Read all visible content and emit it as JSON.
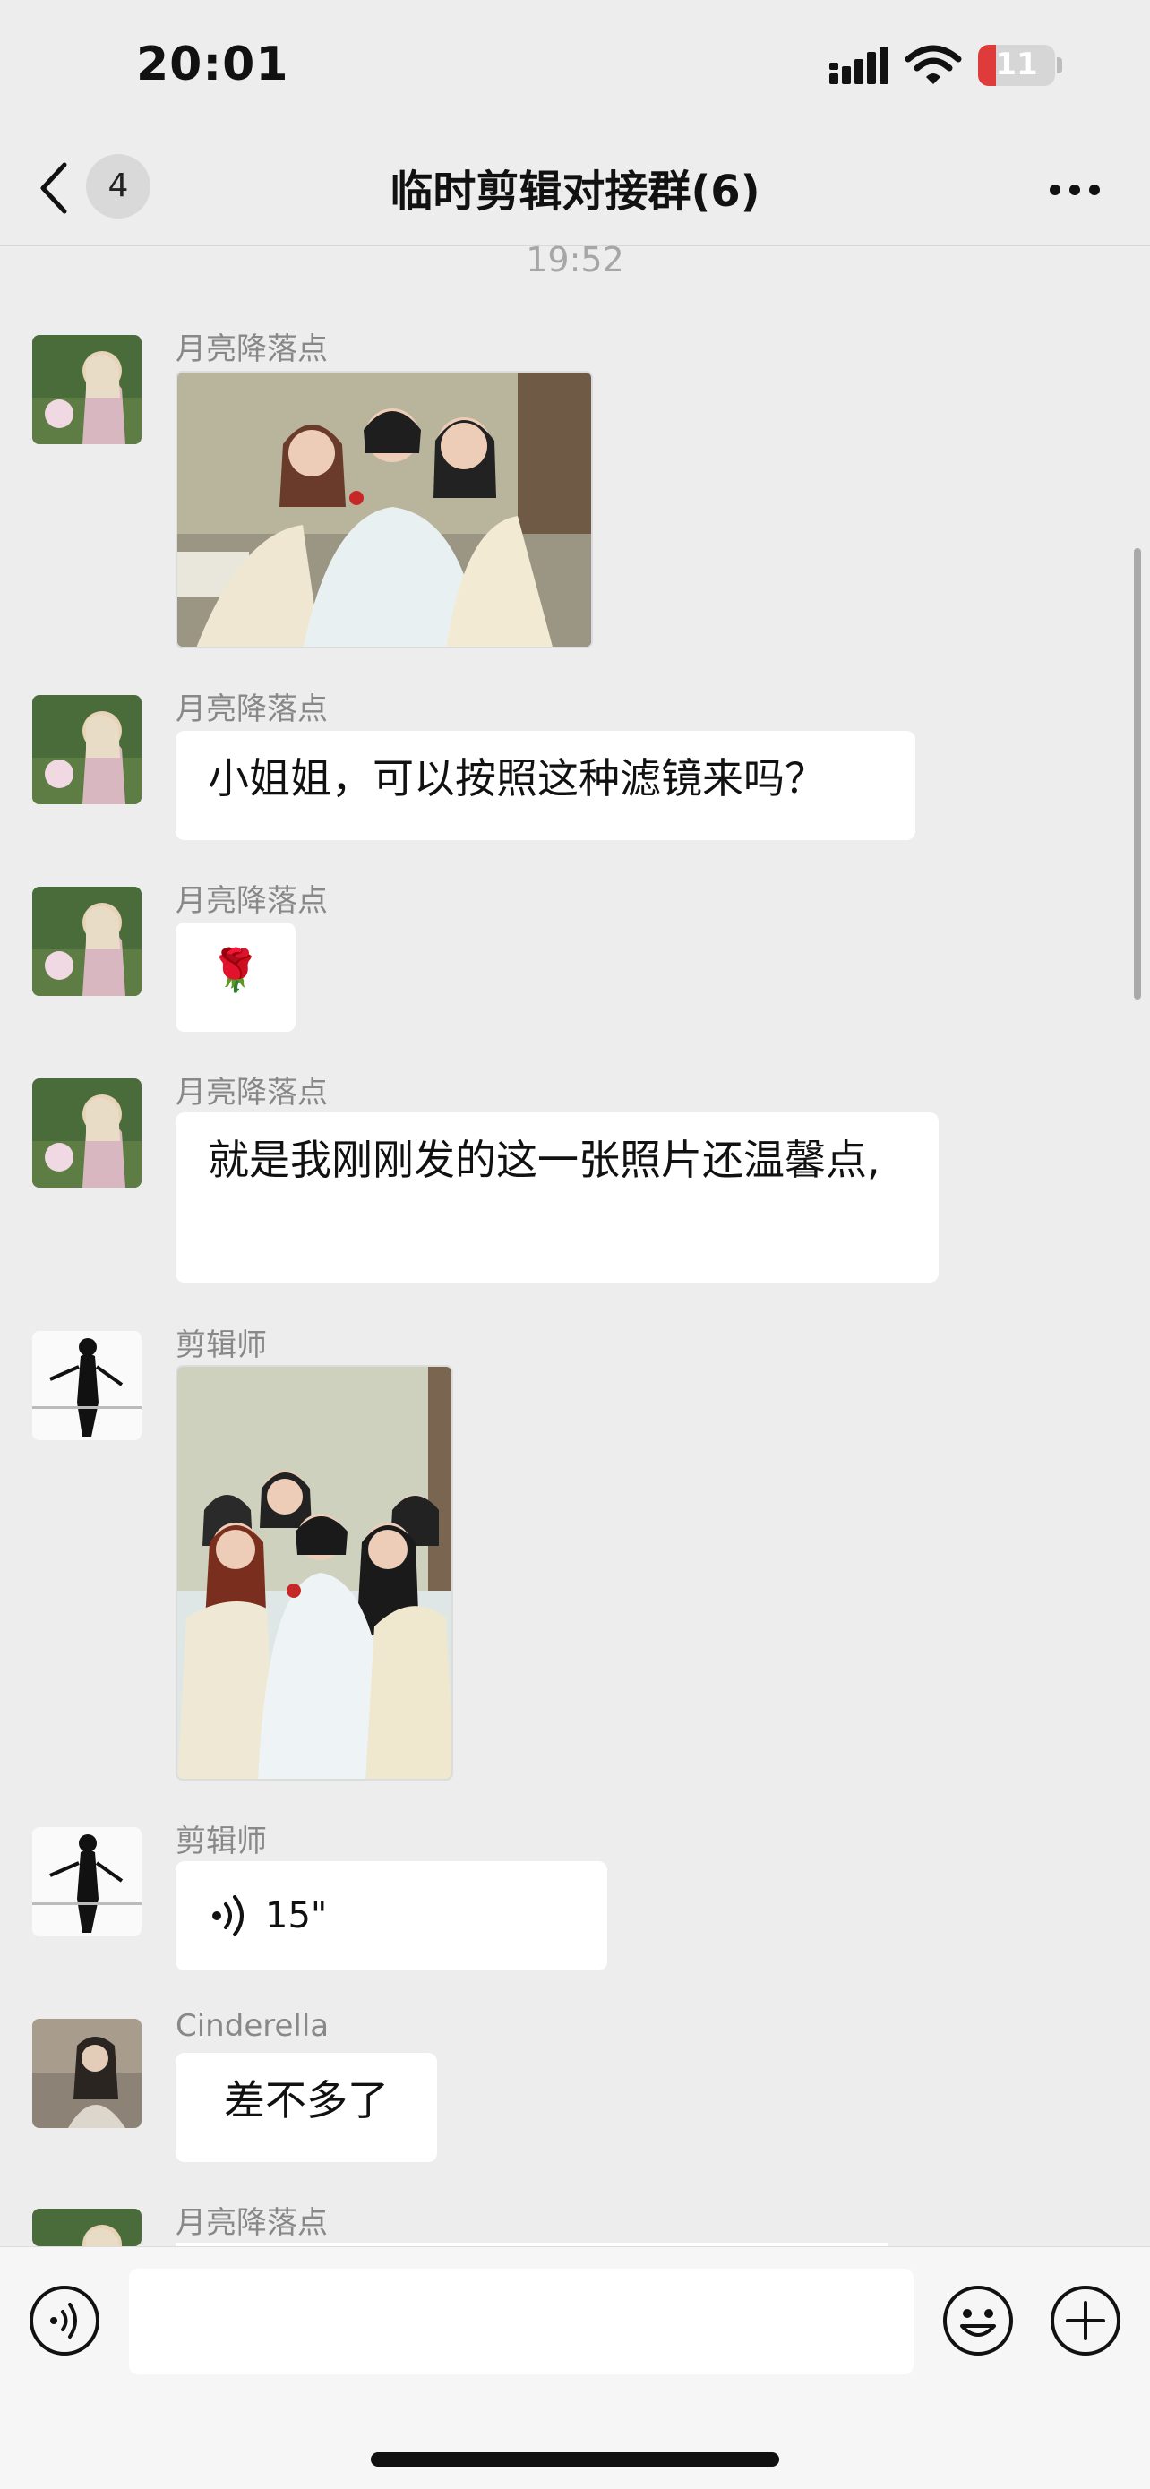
{
  "status_bar": {
    "time": "20:01",
    "battery": "11"
  },
  "nav": {
    "unread_count": "4",
    "title": "临时剪辑对接群(6)"
  },
  "chat": {
    "timestamp": "19:52",
    "messages": [
      {
        "sender": "月亮降落点",
        "type": "image"
      },
      {
        "sender": "月亮降落点",
        "type": "text",
        "text": "小姐姐，可以按照这种滤镜来吗？"
      },
      {
        "sender": "月亮降落点",
        "type": "emoji",
        "text": "🌹"
      },
      {
        "sender": "月亮降落点",
        "type": "text",
        "text": "就是我刚刚发的这一张照片还温馨点,"
      },
      {
        "sender": "剪辑师",
        "type": "image"
      },
      {
        "sender": "剪辑师",
        "type": "voice",
        "text": "15\""
      },
      {
        "sender": "Cinderella",
        "type": "text",
        "text": "差不多了"
      },
      {
        "sender": "月亮降落点",
        "type": "partial"
      }
    ]
  },
  "input_bar": {
    "voice_icon": "voice-icon",
    "emoji_icon": "emoji-icon",
    "plus_icon": "plus-icon"
  }
}
